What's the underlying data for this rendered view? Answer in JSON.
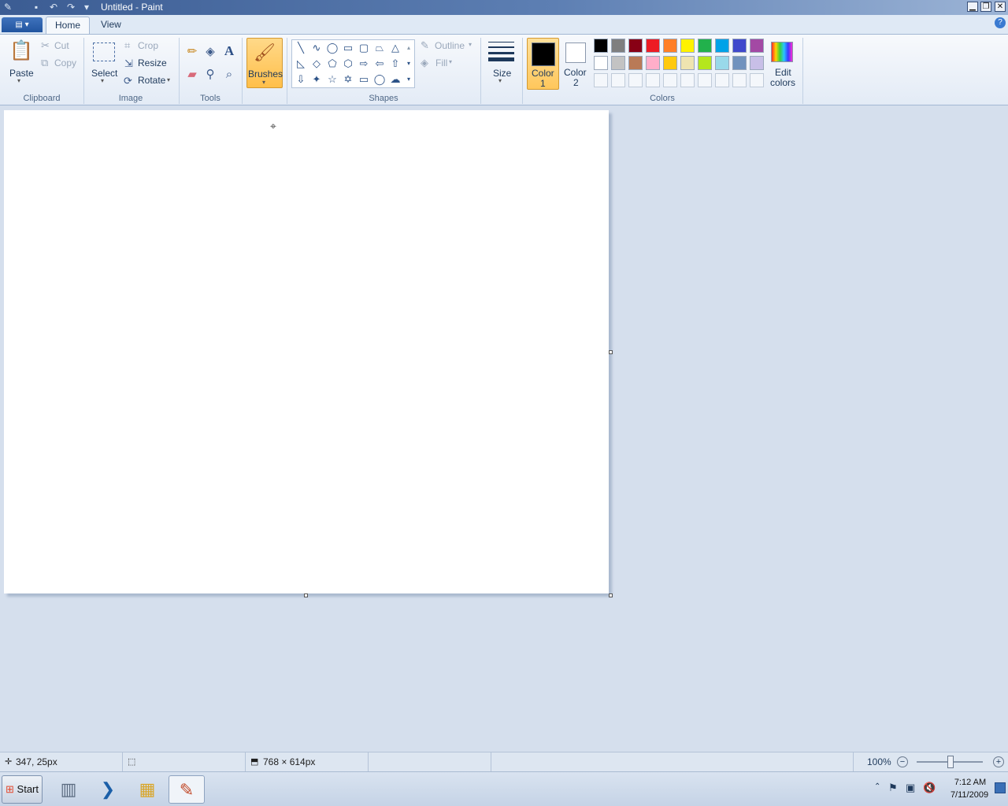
{
  "window": {
    "title": "Untitled - Paint"
  },
  "tabs": [
    {
      "label": "Home",
      "active": true
    },
    {
      "label": "View",
      "active": false
    }
  ],
  "ribbon": {
    "clipboard": {
      "group_label": "Clipboard",
      "paste": "Paste",
      "cut": "Cut",
      "copy": "Copy"
    },
    "image": {
      "group_label": "Image",
      "select": "Select",
      "crop": "Crop",
      "resize": "Resize",
      "rotate": "Rotate"
    },
    "tools": {
      "group_label": "Tools"
    },
    "brushes": {
      "label": "Brushes"
    },
    "shapes": {
      "group_label": "Shapes",
      "outline": "Outline",
      "fill": "Fill"
    },
    "size": {
      "label": "Size"
    },
    "color1": {
      "line1": "Color",
      "line2": "1",
      "value": "#000000"
    },
    "color2": {
      "line1": "Color",
      "line2": "2",
      "value": "#ffffff"
    },
    "colors": {
      "group_label": "Colors",
      "edit_line1": "Edit",
      "edit_line2": "colors",
      "palette_row1": [
        "#000000",
        "#7f7f7f",
        "#880015",
        "#ed1c24",
        "#ff7f27",
        "#fff200",
        "#22b14c",
        "#00a2e8",
        "#3f48cc",
        "#a349a4"
      ],
      "palette_row2": [
        "#ffffff",
        "#c3c3c3",
        "#b97a57",
        "#ffaec9",
        "#ffc90e",
        "#efe4b0",
        "#b5e61d",
        "#99d9ea",
        "#7092be",
        "#c8bfe7"
      ]
    }
  },
  "status": {
    "cursor_pos": "347, 25px",
    "image_size": "768 × 614px",
    "zoom": "100%"
  },
  "taskbar": {
    "start": "Start",
    "clock_time": "7:12 AM",
    "clock_date": "7/11/2009"
  }
}
